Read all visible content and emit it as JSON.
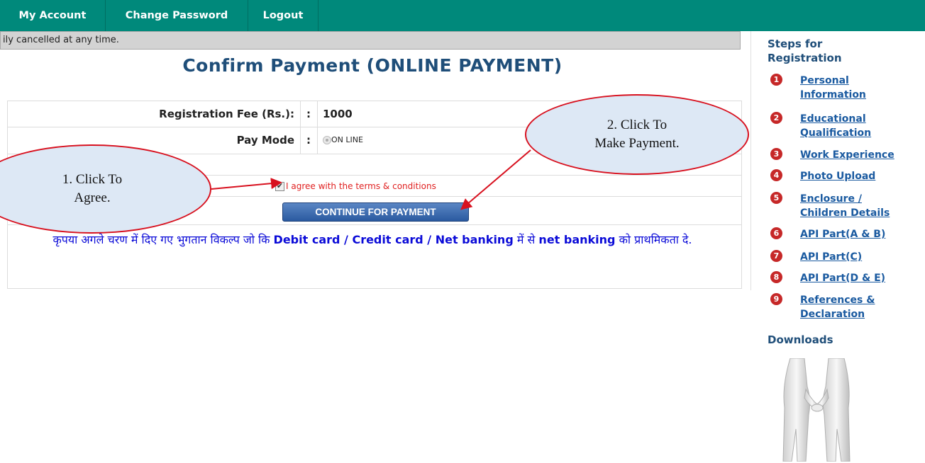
{
  "nav": {
    "items": [
      {
        "label": "My Account"
      },
      {
        "label": "Change Password"
      },
      {
        "label": "Logout"
      }
    ],
    "bg_color": "#00897b"
  },
  "marquee": {
    "text": "ily cancelled at any time."
  },
  "page_title": "Confirm Payment (ONLINE PAYMENT)",
  "form": {
    "fee_label": "Registration Fee (Rs.):",
    "fee_sep": ":",
    "fee_value": "1000",
    "paymode_label": "Pay Mode",
    "paymode_sep": ":",
    "paymode_value": "ON LINE",
    "agree_text": "I agree with the terms & conditions",
    "agree_checked": true,
    "pay_button": "CONTINUE FOR PAYMENT"
  },
  "hindi_notice": {
    "part1": "कृपया अगले चरण में दिए गए भुगतान विकल्प जो कि ",
    "bold1": "Debit card / Credit card / Net banking",
    "part2": " में से ",
    "bold2": "net banking",
    "part3": " को प्राथमिकता दे."
  },
  "callouts": {
    "agree": {
      "line1": "1. Click To",
      "line2": "Agree."
    },
    "pay": {
      "line1": "2. Click To",
      "line2": "Make Payment."
    }
  },
  "sidebar": {
    "title": "Steps for Registration",
    "steps": [
      {
        "num": "1",
        "label": "Personal Information"
      },
      {
        "num": "2",
        "label": "Educational Qualification"
      },
      {
        "num": "3",
        "label": "Work Experience"
      },
      {
        "num": "4",
        "label": "Photo Upload"
      },
      {
        "num": "5",
        "label": "Enclosure / Children Details"
      },
      {
        "num": "6",
        "label": "API Part(A & B)"
      },
      {
        "num": "7",
        "label": "API Part(C)"
      },
      {
        "num": "8",
        "label": "API Part(D & E)"
      },
      {
        "num": "9",
        "label": "References & Declaration"
      }
    ],
    "downloads_label": "Downloads"
  }
}
